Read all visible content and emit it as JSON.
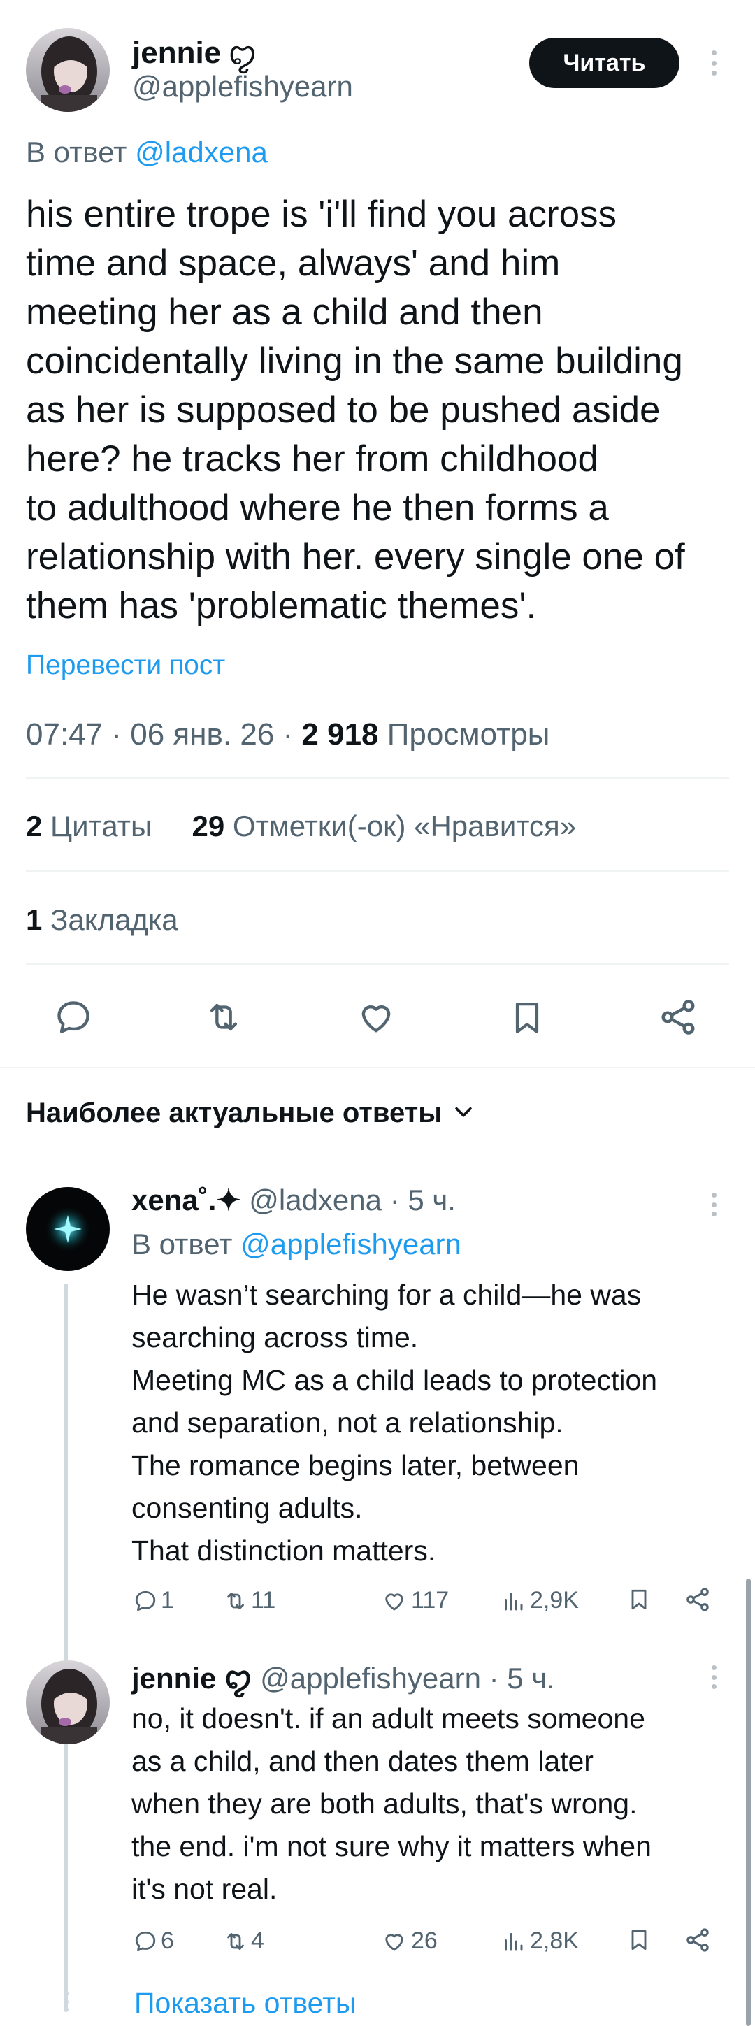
{
  "main_post": {
    "author_name": "jennie",
    "author_glyph": "ꨄ",
    "author_handle": "@applefishyearn",
    "follow_label": "Читать",
    "reply_prefix": "В ответ",
    "reply_to": "@ladxena",
    "text": "his entire trope is 'i'll find you across\ntime and space, always' and him\nmeeting her as a child and then\ncoincidentally living in the same building\nas her is supposed to be pushed aside\nhere? he tracks her from childhood\nto adulthood where he then forms a\nrelationship with her. every single one of\nthem has 'problematic themes'.",
    "translate_label": "Перевести пост",
    "time": "07:47",
    "date": "06 янв. 26",
    "views_count": "2 918",
    "views_label": "Просмотры",
    "quotes_count": "2",
    "quotes_label": "Цитаты",
    "likes_count": "29",
    "likes_label": "Отметки(-ок) «Нравится»",
    "bookmarks_count": "1",
    "bookmarks_label": "Закладка"
  },
  "replies_header": "Наиболее актуальные ответы",
  "replies": [
    {
      "author_name": "xena˚.✦",
      "author_handle": "@ladxena",
      "time": "5 ч.",
      "reply_prefix": "В ответ",
      "reply_to": "@applefishyearn",
      "text": "He wasn’t searching for a child—he was\nsearching across time.\nMeeting MC as a child leads to protection\nand separation, not a relationship.\nThe romance begins later, between\nconsenting adults.\nThat distinction matters.",
      "replies": "1",
      "reposts": "11",
      "likes": "117",
      "views": "2,9K"
    },
    {
      "author_name": "jennie ꨄ",
      "author_handle": "@applefishyearn",
      "time": "5 ч.",
      "text": "no, it doesn't. if an adult meets someone\nas a child, and then dates them later\nwhen they are both adults, that's wrong.\nthe end. i'm not sure why it matters when\nit's not real.",
      "replies": "6",
      "reposts": "4",
      "likes": "26",
      "views": "2,8K"
    }
  ],
  "show_replies_label": "Показать ответы",
  "colors": {
    "accent": "#1d9bf0",
    "text": "#0f1419",
    "muted": "#536471",
    "divider": "#eff3f4"
  }
}
